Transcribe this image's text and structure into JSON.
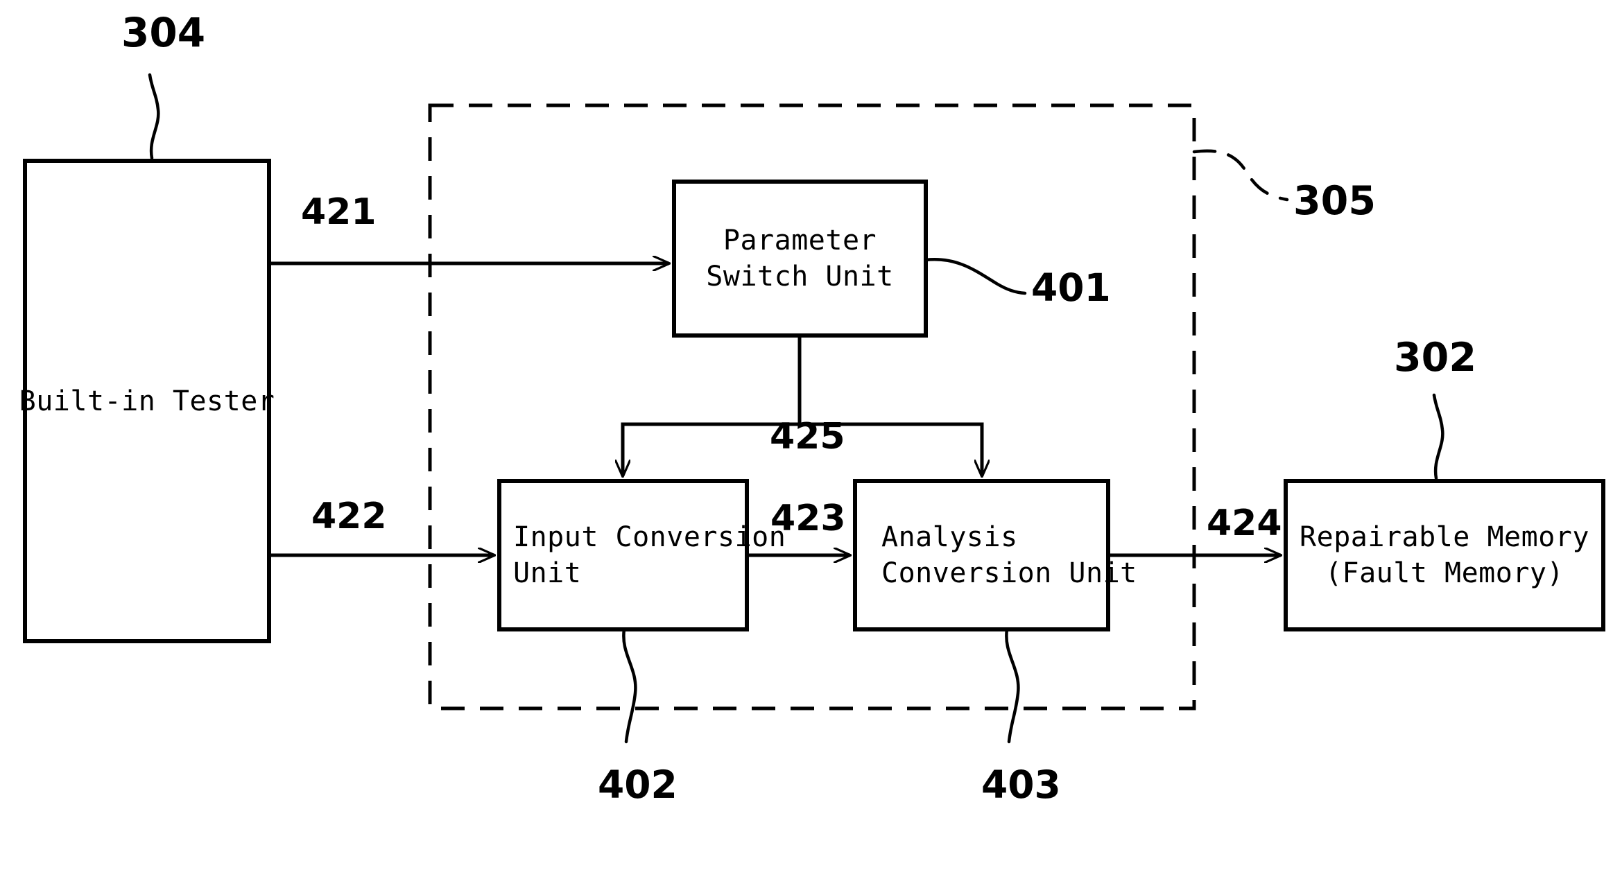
{
  "figure": {
    "type": "patent-block-diagram",
    "background": "#ffffff",
    "stroke": "#000000"
  },
  "blocks": {
    "built_in_tester": {
      "label": "Built-in Tester",
      "ref": "304"
    },
    "parameter_switch_unit": {
      "line1": "Parameter",
      "line2": "Switch Unit",
      "ref": "401"
    },
    "input_conversion_unit": {
      "line1": "Input Conversion",
      "line2": "Unit",
      "ref": "402"
    },
    "analysis_conversion_unit": {
      "line1": "Analysis",
      "line2": "Conversion Unit",
      "ref": "403"
    },
    "repairable_memory": {
      "line1": "Repairable Memory",
      "line2": "(Fault Memory)",
      "ref": "302"
    },
    "dashed_enclosure": {
      "ref": "305"
    }
  },
  "connections": {
    "tester_to_parameter_switch": "421",
    "tester_to_input_conversion": "422",
    "input_to_analysis": "423",
    "analysis_to_memory": "424",
    "parameter_switch_branch": "425"
  },
  "reference_numerals": {
    "n304": "304",
    "n305": "305",
    "n302": "302",
    "n401": "401",
    "n402": "402",
    "n403": "403",
    "n421": "421",
    "n422": "422",
    "n423": "423",
    "n424": "424",
    "n425": "425"
  }
}
